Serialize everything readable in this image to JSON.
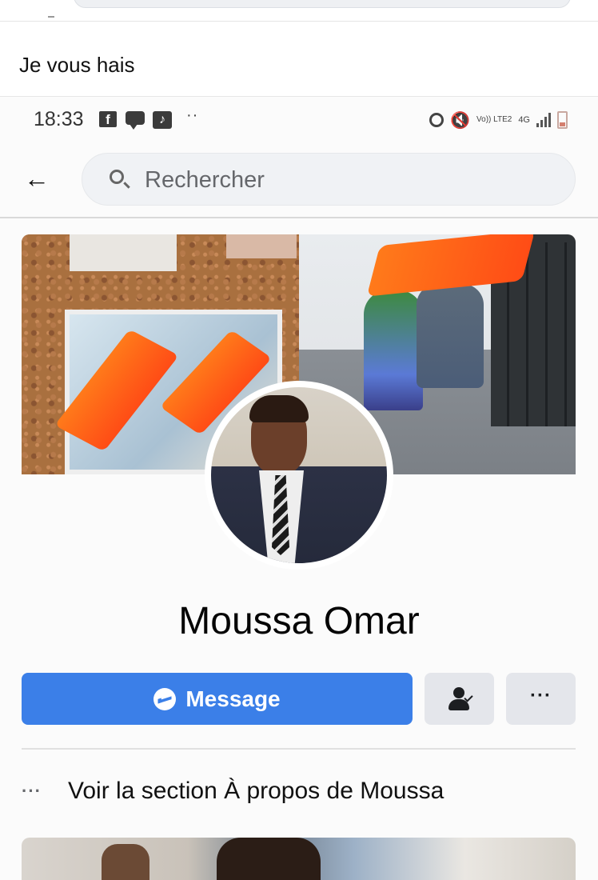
{
  "caption": "Je vous hais",
  "status_bar": {
    "time": "18:33",
    "left_icons": [
      "facebook-icon",
      "message-icon",
      "tiktok-icon"
    ],
    "overflow": "··",
    "volte": "Vo)) LTE2",
    "network": "4G",
    "right_icons": [
      "alarm-icon",
      "mute-icon",
      "signal-icon",
      "battery-icon"
    ]
  },
  "search": {
    "placeholder": "Rechercher"
  },
  "profile": {
    "name": "Moussa Omar"
  },
  "actions": {
    "message_label": "Message",
    "more_label": "···",
    "accent": "#3b7fe8"
  },
  "about": {
    "dots": "···",
    "label": "Voir la section À propos de Moussa"
  }
}
